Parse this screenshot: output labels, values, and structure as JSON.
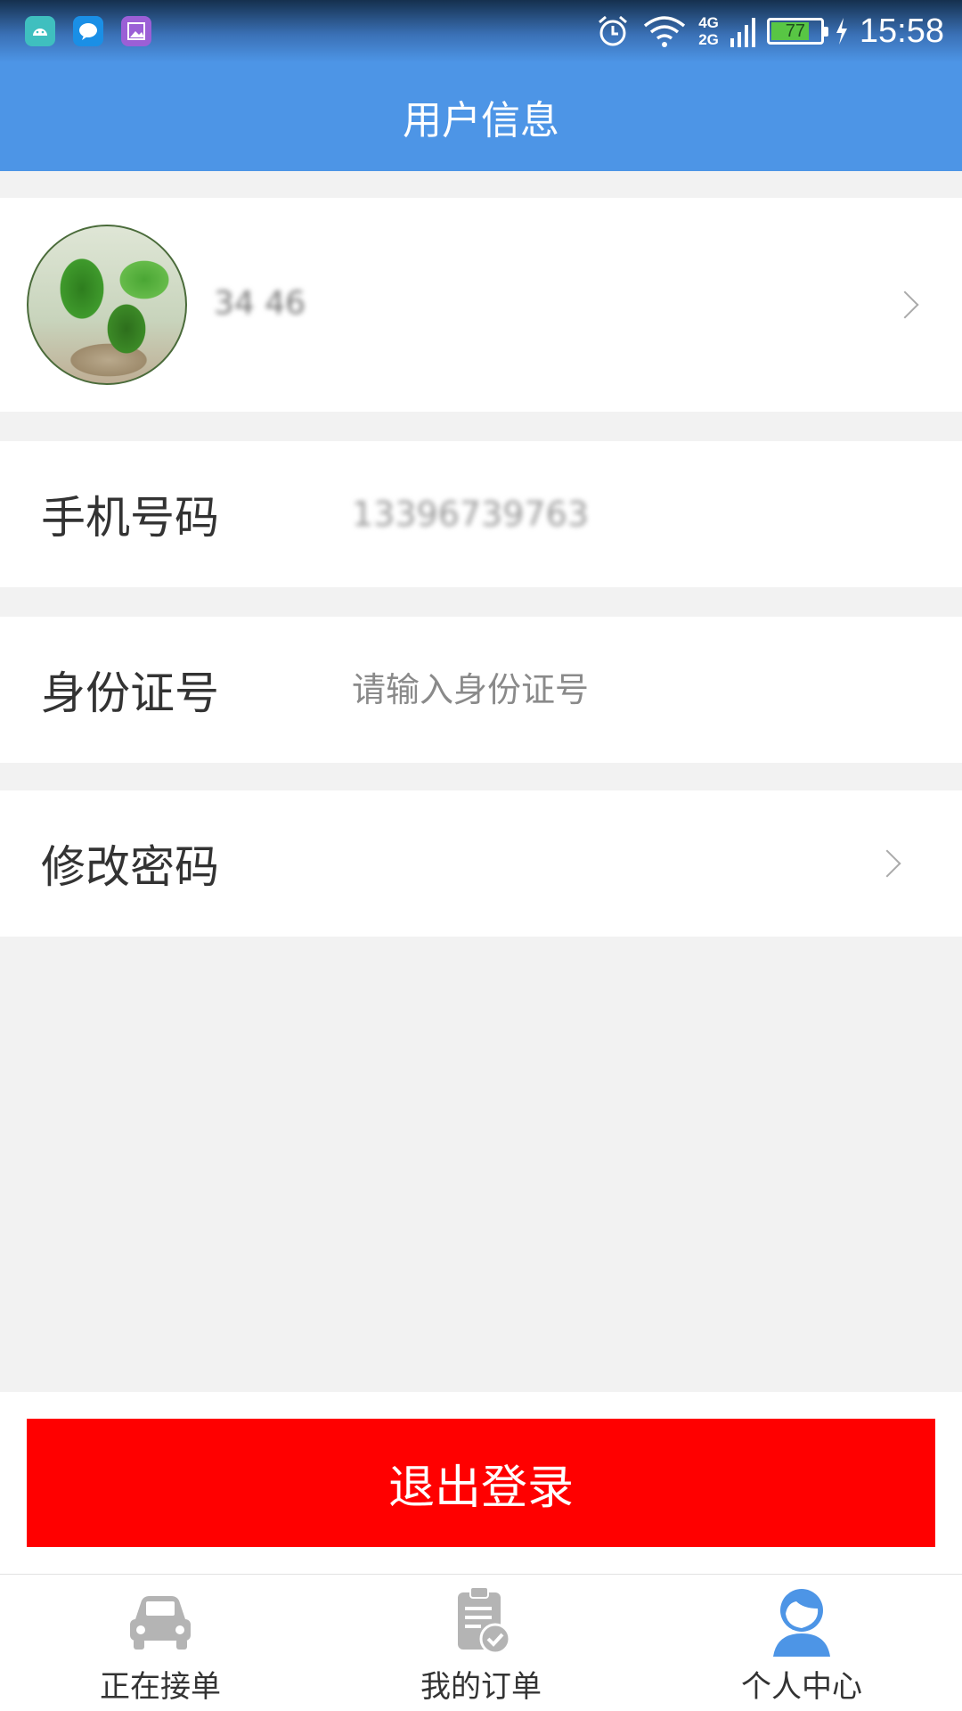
{
  "status_bar": {
    "time": "15:58",
    "battery": "77",
    "battery_level": 0.77,
    "network_top": "4G",
    "network_bottom": "2G",
    "app_icons": [
      "android-icon",
      "message-icon",
      "gallery-icon"
    ]
  },
  "header": {
    "title": "用户信息"
  },
  "profile": {
    "name": "34 46"
  },
  "fields": {
    "phone": {
      "label": "手机号码",
      "value": "13396739763"
    },
    "id_number": {
      "label": "身份证号",
      "placeholder": "请输入身份证号"
    },
    "password": {
      "label": "修改密码"
    }
  },
  "logout": {
    "label": "退出登录"
  },
  "nav": {
    "items": [
      {
        "label": "正在接单",
        "icon": "car-icon"
      },
      {
        "label": "我的订单",
        "icon": "clipboard-check-icon"
      },
      {
        "label": "个人中心",
        "icon": "person-icon"
      }
    ],
    "active_index": 2
  },
  "colors": {
    "header": "#4d95e6",
    "logout": "#ff0000",
    "nav_active": "#4d95e6",
    "nav_inactive": "#b4b4b4"
  }
}
